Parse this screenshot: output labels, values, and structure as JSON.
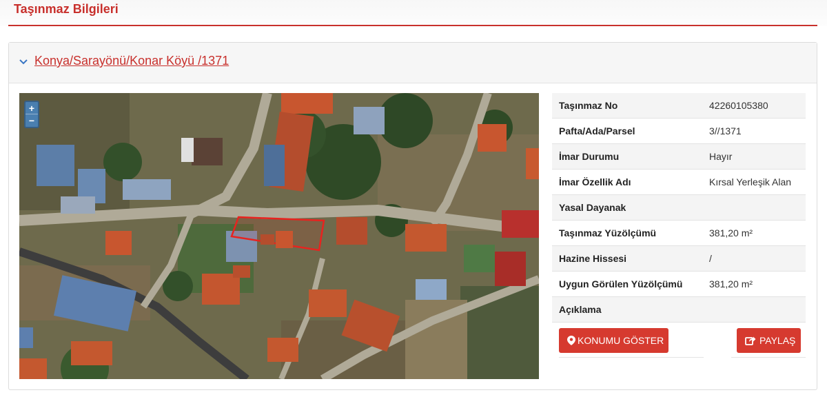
{
  "page": {
    "title": "Taşınmaz Bilgileri"
  },
  "panel": {
    "heading": "Konya/Sarayönü/Konar Köyü /1371"
  },
  "map": {
    "zoom_in": "+",
    "zoom_out": "−"
  },
  "info": {
    "rows": [
      {
        "label": "Taşınmaz No",
        "value": "42260105380"
      },
      {
        "label": "Pafta/Ada/Parsel",
        "value": "3//1371"
      },
      {
        "label": "İmar Durumu",
        "value": "Hayır"
      },
      {
        "label": "İmar Özellik Adı",
        "value": "Kırsal Yerleşik Alan"
      },
      {
        "label": "Yasal Dayanak",
        "value": ""
      },
      {
        "label": "Taşınmaz Yüzölçümü",
        "value": "381,20 m²"
      },
      {
        "label": "Hazine Hissesi",
        "value": "/"
      },
      {
        "label": "Uygun Görülen Yüzölçümü",
        "value": "381,20 m²"
      },
      {
        "label": "Açıklama",
        "value": ""
      }
    ]
  },
  "actions": {
    "show_location": "KONUMU GÖSTER",
    "share": "PAYLAŞ"
  },
  "colors": {
    "accent": "#c8302c",
    "button": "#d63a2f",
    "parcel_outline": "#e8231f"
  }
}
